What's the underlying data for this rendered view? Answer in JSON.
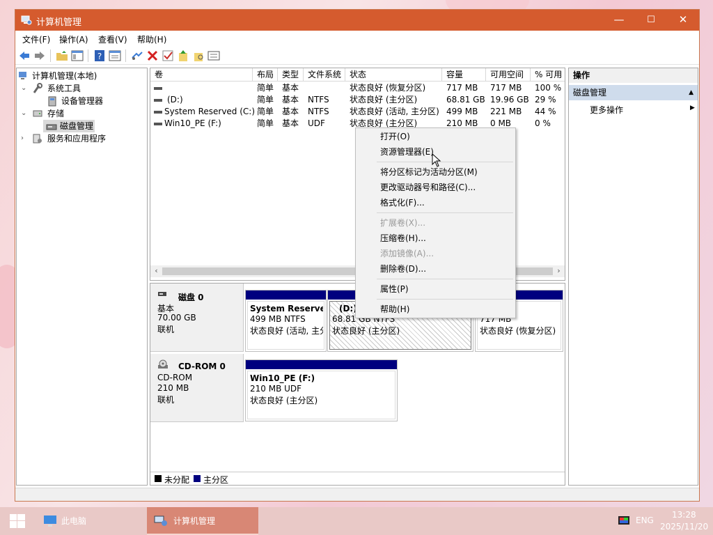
{
  "window": {
    "title": "计算机管理",
    "controls": {
      "minimize": "—",
      "maximize": "☐",
      "close": "✕"
    }
  },
  "menu": [
    "文件(F)",
    "操作(A)",
    "查看(V)",
    "帮助(H)"
  ],
  "toolbar": [
    "back-icon",
    "forward-icon",
    "up-folder-icon",
    "show-hide-tree-icon",
    "help-icon",
    "properties-icon",
    "connect-icon",
    "delete-icon",
    "check-icon",
    "import-icon",
    "export-icon",
    "list-icon"
  ],
  "tree": {
    "root": "计算机管理(本地)",
    "system_tools": "系统工具",
    "device_manager": "设备管理器",
    "storage": "存储",
    "disk_management": "磁盘管理",
    "services": "服务和应用程序"
  },
  "volume_columns": [
    "卷",
    "布局",
    "类型",
    "文件系统",
    "状态",
    "容量",
    "可用空间",
    "% 可用"
  ],
  "volumes": [
    {
      "name": "",
      "layout": "简单",
      "type": "基本",
      "fs": "",
      "status": "状态良好 (恢复分区)",
      "capacity": "717 MB",
      "free": "717 MB",
      "pct": "100 %"
    },
    {
      "name": "(D:)",
      "layout": "简单",
      "type": "基本",
      "fs": "NTFS",
      "status": "状态良好 (主分区)",
      "capacity": "68.81 GB",
      "free": "19.96 GB",
      "pct": "29 %"
    },
    {
      "name": "System Reserved (C:)",
      "layout": "简单",
      "type": "基本",
      "fs": "NTFS",
      "status": "状态良好 (活动, 主分区)",
      "capacity": "499 MB",
      "free": "221 MB",
      "pct": "44 %"
    },
    {
      "name": "Win10_PE (F:)",
      "layout": "简单",
      "type": "基本",
      "fs": "UDF",
      "status": "状态良好 (主分区)",
      "capacity": "210 MB",
      "free": "0 MB",
      "pct": "0 %"
    }
  ],
  "disks": {
    "disk0": {
      "name": "磁盘 0",
      "kind": "基本",
      "size": "70.00 GB",
      "state": "联机"
    },
    "cdrom0": {
      "name": "CD-ROM 0",
      "kind": "CD-ROM",
      "size": "210 MB",
      "state": "联机"
    }
  },
  "partitions": {
    "sysres": {
      "name": "System Reserve",
      "size": "499 MB NTFS",
      "status": "状态良好 (活动, 主分"
    },
    "d": {
      "name": "(D:)",
      "size": "68.81 GB NTFS",
      "status": "状态良好 (主分区)"
    },
    "rec": {
      "name": "",
      "size": "717 MB",
      "status": "状态良好 (恢复分区)"
    },
    "pe": {
      "name": "Win10_PE   (F:)",
      "size": "210 MB UDF",
      "status": "状态良好 (主分区)"
    }
  },
  "legend": {
    "unallocated": "未分配",
    "primary": "主分区"
  },
  "actions": {
    "header": "操作",
    "selected": "磁盘管理",
    "more": "更多操作"
  },
  "context_menu": {
    "open": "打开(O)",
    "explorer": "资源管理器(E)",
    "mark_active": "将分区标记为活动分区(M)",
    "change_letter": "更改驱动器号和路径(C)...",
    "format": "格式化(F)...",
    "extend": "扩展卷(X)...",
    "shrink": "压缩卷(H)...",
    "mirror": "添加镜像(A)...",
    "delete": "删除卷(D)...",
    "properties": "属性(P)",
    "help": "帮助(H)"
  },
  "taskbar": {
    "this_pc": "此电脑",
    "computer_management": "计算机管理",
    "lang": "ENG",
    "time": "13:28",
    "date": "2025/11/20"
  },
  "colors": {
    "titlebar": "#d55b2e",
    "primary_partition": "#00007f",
    "selection": "#cfdcec"
  }
}
